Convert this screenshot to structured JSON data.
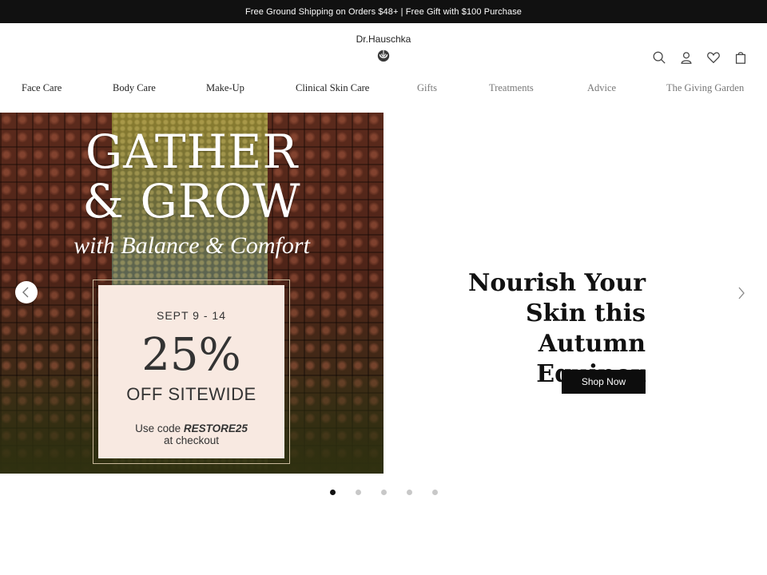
{
  "promo_bar": {
    "text": "Free Ground Shipping on Orders $48+ | Free Gift with $100 Purchase"
  },
  "header": {
    "logo_text": "Dr.Hauschka",
    "icons": [
      "search-icon",
      "account-icon",
      "wishlist-heart-icon",
      "shopping-bag-icon"
    ]
  },
  "nav": {
    "items": [
      {
        "label": "Face Care"
      },
      {
        "label": "Body Care"
      },
      {
        "label": "Make-Up"
      },
      {
        "label": "Clinical Skin Care"
      },
      {
        "label": "Gifts"
      },
      {
        "label": "Treatments"
      },
      {
        "label": "Advice"
      },
      {
        "label": "The Giving Garden"
      }
    ]
  },
  "hero": {
    "image": {
      "title_line1": "GATHER",
      "title_line2": "& GROW",
      "subtitle": "with Balance & Comfort",
      "offer_dates": "SEPT 9 - 14",
      "offer_percent": "25%",
      "offer_label": "OFF SITEWIDE",
      "offer_code_prefix": "Use code ",
      "offer_code": "RESTORE25",
      "offer_code_suffix": "at checkout"
    },
    "heading_line1": "Nourish Your",
    "heading_line2": "Skin this Autumn",
    "heading_line3": "Equinox",
    "cta_label": "Shop Now",
    "prev_icon": "chevron-left-icon",
    "next_icon": "chevron-right-icon"
  },
  "carousel": {
    "slide_count": 5,
    "active_index": 0
  },
  "colors": {
    "promo_bg": "#111111",
    "button_bg": "#0d0d0d",
    "offer_bg": "#f8e9e1",
    "dot_inactive": "#c8c8c8"
  }
}
